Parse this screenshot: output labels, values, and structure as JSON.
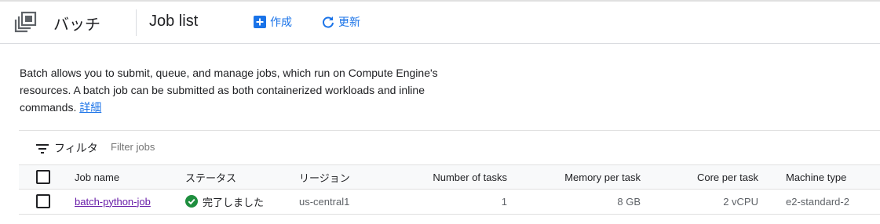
{
  "header": {
    "service_name": "バッチ",
    "page_title": "Job list",
    "actions": {
      "create": "作成",
      "refresh": "更新"
    }
  },
  "description": {
    "text": "Batch allows you to submit, queue, and manage jobs, which run on Compute Engine's resources. A batch job can be submitted as both containerized workloads and inline commands. ",
    "link": "詳細"
  },
  "filter": {
    "label": "フィルタ",
    "placeholder": "Filter jobs"
  },
  "table": {
    "columns": {
      "name": "Job name",
      "status": "ステータス",
      "region": "リージョン",
      "tasks": "Number of tasks",
      "memory": "Memory per task",
      "core": "Core per task",
      "machine": "Machine type"
    },
    "rows": [
      {
        "name": "batch-python-job",
        "status": "完了しました",
        "region": "us-central1",
        "tasks": "1",
        "memory": "8 GB",
        "core": "2 vCPU",
        "machine": "e2-standard-2"
      }
    ]
  },
  "icons": {
    "service": "batch-icon",
    "create": "plus-box-icon",
    "refresh": "refresh-icon",
    "filter": "filter-icon",
    "status_ok": "check-circle-icon"
  },
  "colors": {
    "accent": "#1a73e8",
    "visited_link": "#681da8",
    "success": "#1e8e3e",
    "text": "#202124",
    "muted": "#5f6368"
  }
}
